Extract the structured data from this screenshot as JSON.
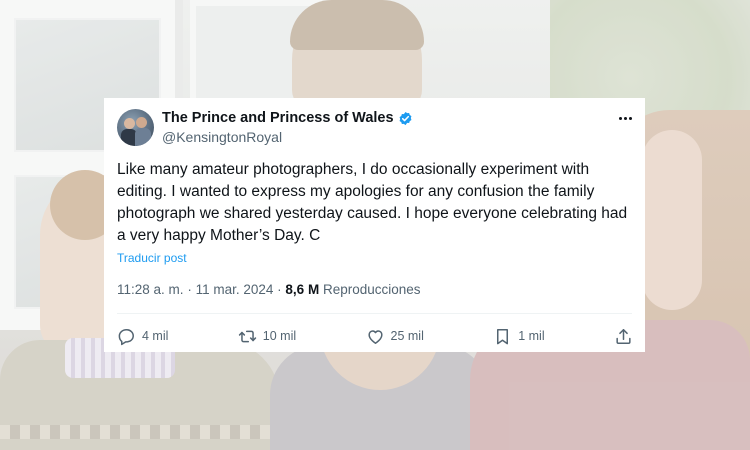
{
  "tweet": {
    "author_name": "The Prince and Princess of Wales",
    "handle": "@KensingtonRoyal",
    "text": "Like many amateur photographers, I do occasionally experiment with editing. I wanted to express my apologies for any confusion the family photograph we shared yesterday caused. I hope everyone celebrating had a very happy Mother’s Day. C",
    "translate_label": "Traducir post",
    "time": "11:28 a. m.",
    "separator": "·",
    "date": "11 mar. 2024",
    "views_count": "8,6 M",
    "views_label": "Reproducciones",
    "replies": "4 mil",
    "reposts": "10 mil",
    "likes": "25 mil",
    "bookmarks": "1 mil"
  },
  "icons": {
    "verified": "verified-badge-icon",
    "more": "more-options-icon",
    "reply": "reply-icon",
    "repost": "repost-icon",
    "like": "heart-icon",
    "bookmark": "bookmark-icon",
    "share": "share-icon"
  },
  "colors": {
    "accent": "#1d9bf0",
    "text": "#0f1419",
    "secondary_text": "#536471"
  }
}
